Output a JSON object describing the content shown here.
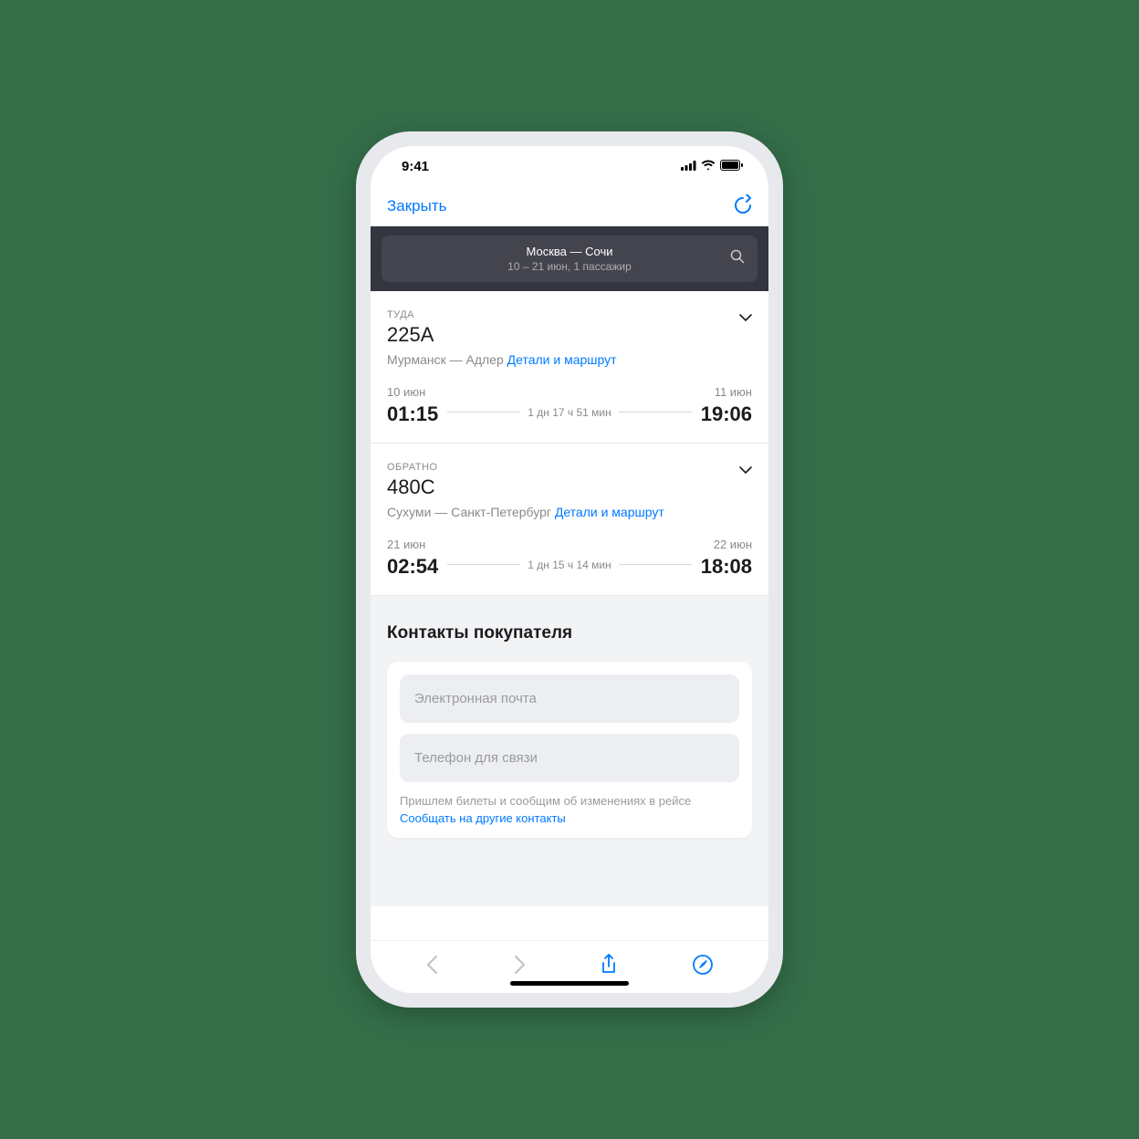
{
  "status": {
    "time": "9:41"
  },
  "nav": {
    "close": "Закрыть"
  },
  "search": {
    "route": "Москва — Сочи",
    "sub": "10 – 21 июн, 1 пассажир"
  },
  "trips": {
    "outbound": {
      "dir": "ТУДА",
      "num": "225А",
      "route": "Мурманск — Адлер ",
      "link": "Детали и маршрут",
      "dep_date": "10 июн",
      "dep_time": "01:15",
      "duration": "1 дн 17 ч 51 мин",
      "arr_date": "11 июн",
      "arr_time": "19:06"
    },
    "return": {
      "dir": "ОБРАТНО",
      "num": "480С",
      "route": "Сухуми — Санкт-Петербург ",
      "link": "Детали и маршрут",
      "dep_date": "21 июн",
      "dep_time": "02:54",
      "duration": "1 дн 15 ч 14 мин",
      "arr_date": "22 июн",
      "arr_time": "18:08"
    }
  },
  "contacts": {
    "title": "Контакты покупателя",
    "email_placeholder": "Электронная почта",
    "phone_placeholder": "Телефон для связи",
    "note": "Пришлем билеты и сообщим об изменениях в рейсе",
    "note_link": "Сообщать на другие контакты"
  }
}
